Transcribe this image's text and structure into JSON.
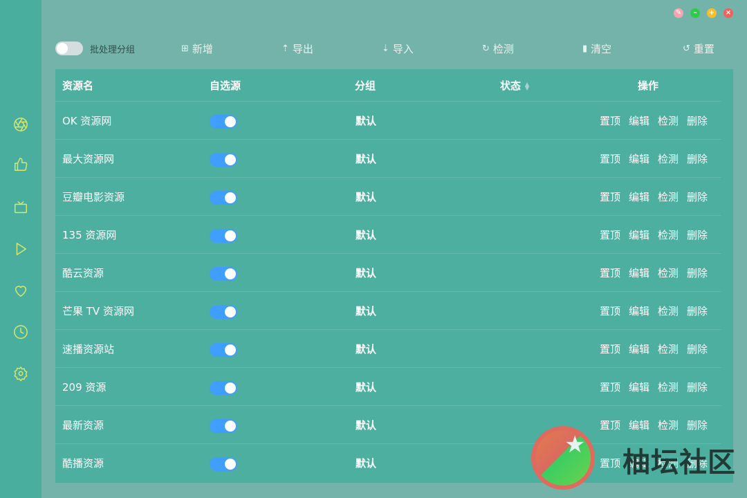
{
  "window_controls": [
    "pin",
    "minimize",
    "maximize",
    "close"
  ],
  "sidebar": {
    "icons": [
      "aperture-icon",
      "thumbs-up-icon",
      "tv-icon",
      "play-icon",
      "heart-icon",
      "clock-icon",
      "settings-icon"
    ]
  },
  "toolbar": {
    "batch_label": "批处理分组",
    "batch_enabled": false,
    "buttons": [
      {
        "label": "新增",
        "icon": "file-add-icon"
      },
      {
        "label": "导出",
        "icon": "upload-icon"
      },
      {
        "label": "导入",
        "icon": "download-icon"
      },
      {
        "label": "检测",
        "icon": "refresh-icon"
      },
      {
        "label": "清空",
        "icon": "trash-icon"
      },
      {
        "label": "重置",
        "icon": "reset-icon"
      }
    ]
  },
  "table": {
    "headers": {
      "name": "资源名",
      "selected": "自选源",
      "group": "分组",
      "status": "状态",
      "actions": "操作"
    },
    "action_labels": [
      "置顶",
      "编辑",
      "检测",
      "删除"
    ],
    "rows": [
      {
        "name": "OK 资源网",
        "selected": true,
        "group": "默认"
      },
      {
        "name": "最大资源网",
        "selected": true,
        "group": "默认"
      },
      {
        "name": "豆瓣电影资源",
        "selected": true,
        "group": "默认"
      },
      {
        "name": "135 资源网",
        "selected": true,
        "group": "默认"
      },
      {
        "name": "酷云资源",
        "selected": true,
        "group": "默认"
      },
      {
        "name": "芒果 TV 资源网",
        "selected": true,
        "group": "默认"
      },
      {
        "name": "速播资源站",
        "selected": true,
        "group": "默认"
      },
      {
        "name": "209 资源",
        "selected": true,
        "group": "默认"
      },
      {
        "name": "最新资源",
        "selected": true,
        "group": "默认"
      },
      {
        "name": "酷播资源",
        "selected": true,
        "group": "默认"
      }
    ]
  },
  "watermark": {
    "text": "柚坛社区"
  },
  "colors": {
    "background": "#74b3a9",
    "sidebar": "#4aae9e",
    "table": "#4daf9f",
    "switch_on": "#409eff",
    "sidebar_icon": "#d9e86a"
  }
}
